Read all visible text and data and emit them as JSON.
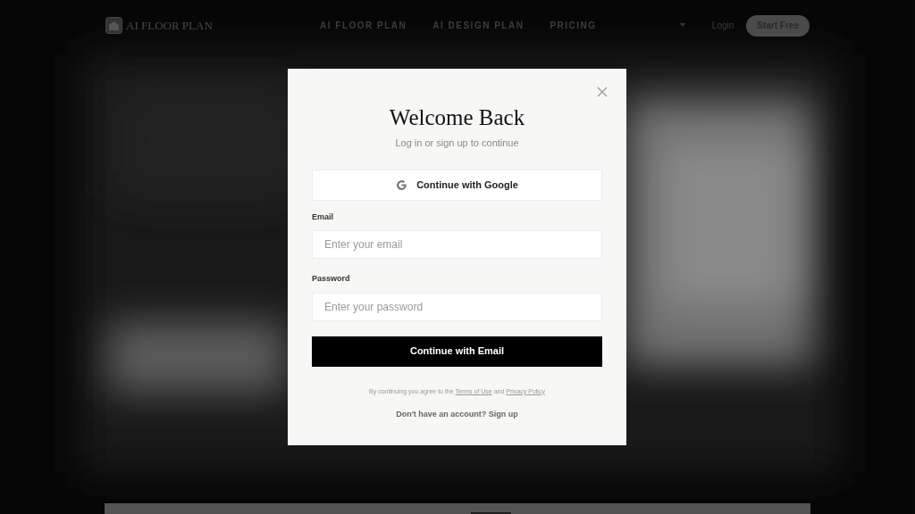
{
  "nav": {
    "logo": "AI FLOOR PLAN",
    "links": [
      "AI FLOOR PLAN",
      "AI DESIGN PLAN",
      "PRICING"
    ],
    "login": "Login",
    "cta": "Start Free"
  },
  "modal": {
    "title": "Welcome Back",
    "subtitle": "Log in or sign up to continue",
    "google_button": "Continue with Google",
    "fields": [
      {
        "label": "Email",
        "placeholder": "Enter your email"
      },
      {
        "label": "Password",
        "placeholder": "Enter your password"
      }
    ],
    "submit": "Continue with Email",
    "terms": {
      "before": "By continuing you agree to the",
      "terms_link": "Terms of Use",
      "middle": "and",
      "privacy_link": "Privacy Policy"
    },
    "signup": {
      "prompt": "Don't have an account?",
      "link": "Sign up"
    }
  }
}
